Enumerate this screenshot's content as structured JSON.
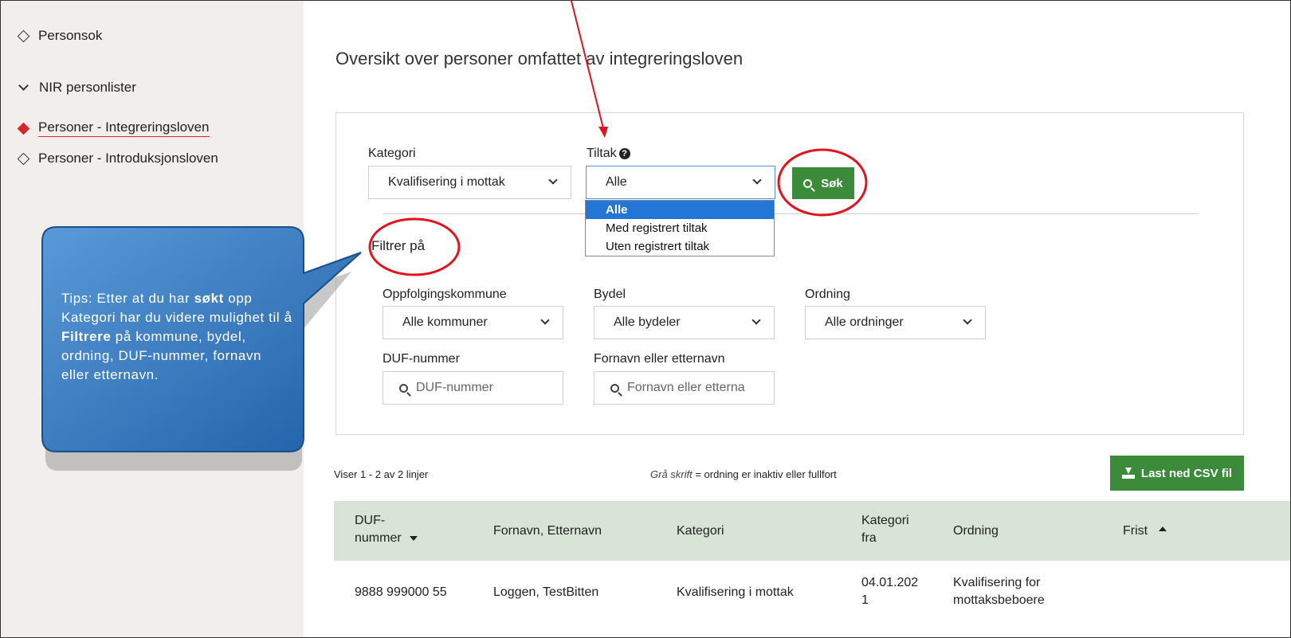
{
  "sidebar": {
    "items": [
      {
        "label": "Personsok"
      },
      {
        "label": "NIR personlister"
      },
      {
        "label": "Personer - Integreringsloven"
      },
      {
        "label": "Personer - Introduksjonsloven"
      }
    ]
  },
  "main": {
    "title": "Oversikt over personer omfattet av integreringsloven",
    "kategori": {
      "label": "Kategori",
      "value": "Kvalifisering i mottak"
    },
    "tiltak": {
      "label": "Tiltak",
      "value": "Alle",
      "options": [
        "Alle",
        "Med registrert tiltak",
        "Uten registrert tiltak"
      ]
    },
    "search_button": "Søk",
    "filter_heading": "Filtrer på",
    "oppfolgingskommune": {
      "label": "Oppfolgingskommune",
      "value": "Alle kommuner"
    },
    "bydel": {
      "label": "Bydel",
      "value": "Alle bydeler"
    },
    "ordning": {
      "label": "Ordning",
      "value": "Alle ordninger"
    },
    "duf": {
      "label": "DUF-nummer",
      "placeholder": "DUF-nummer"
    },
    "navn": {
      "label": "Fornavn eller etternavn",
      "placeholder": "Fornavn eller etterna"
    }
  },
  "results": {
    "count_text": "Viser 1 - 2 av 2 linjer",
    "legend_italic": "Grå skrift",
    "legend_rest": " = ordning er inaktiv eller fullfort",
    "csv_button": "Last ned CSV fil",
    "headers": {
      "duf_line1": "DUF-",
      "duf_line2": "nummer",
      "name": "Fornavn, Etternavn",
      "kategori": "Kategori",
      "kategori_fra_line1": "Kategori",
      "kategori_fra_line2": "fra",
      "ordning": "Ordning",
      "frist": "Frist"
    },
    "rows": [
      {
        "duf": "9888 999000 55",
        "name": "Loggen, TestBitten",
        "kategori": "Kvalifisering i mottak",
        "fra_line1": "04.01.202",
        "fra_line2": "1",
        "ordning_line1": "Kvalifisering for",
        "ordning_line2": "mottaksbeboere"
      }
    ]
  },
  "callout": {
    "part1": "Tips: Etter at du har ",
    "bold1": "søkt",
    "part2": " opp Kategori har du videre mulighet til å ",
    "bold2": "Filtrere",
    "part3": " på kommune, bydel, ordning, DUF-nummer, fornavn eller etternavn."
  },
  "colors": {
    "accent_green": "#3c8b3a",
    "highlight_red": "#e0141e",
    "active_marker": "#d9252c",
    "callout_blue": "#2f78c4",
    "table_header_bg": "#d8e4d6"
  }
}
